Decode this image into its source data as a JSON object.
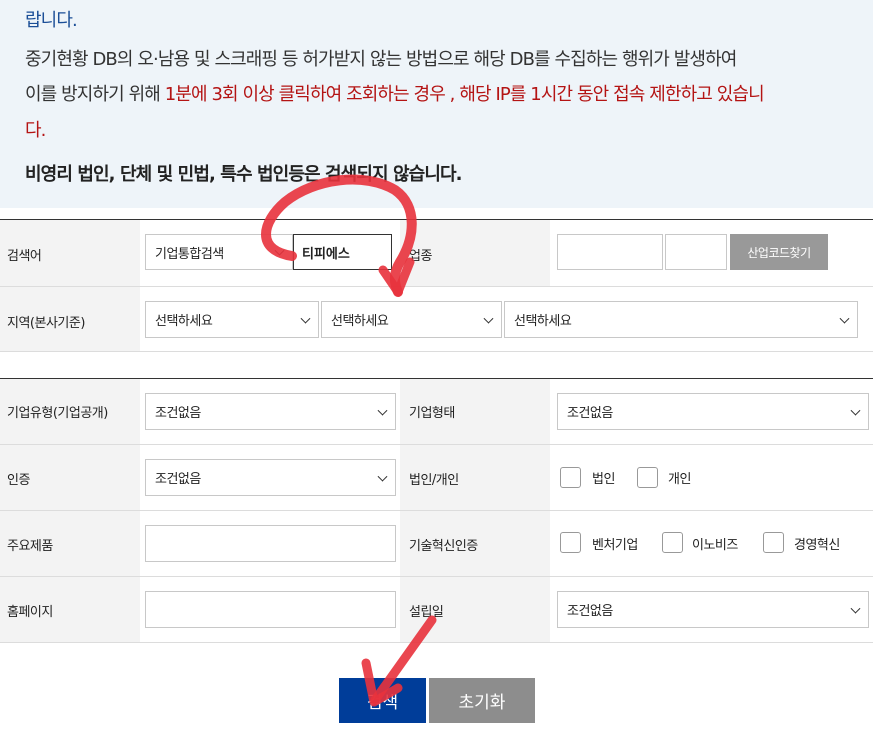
{
  "notice": {
    "line1": "랍니다.",
    "line2": "중기현황 DB의 오·남용 및 스크래핑 등 허가받지 않는 방법으로 해당 DB를 수집하는 행위가 발생하여",
    "line3_prefix": "이를 방지하기 위해 ",
    "line3_red": "1분에 3회 이상 클릭하여 조회하는 경우 , 해당 IP를 1시간 동안 접속 제한하고 있습니",
    "line4_red": "다.",
    "line5": "비영리 법인, 단체 및 민법, 특수 법인등은 검색되지 않습니다."
  },
  "search": {
    "keyword_label": "검색어",
    "keyword_type": "기업통합검색",
    "keyword_value": "티피에스",
    "industry_label": "업종",
    "industry_code_button": "산업코드찾기",
    "region_label": "지역(본사기준)",
    "region_placeholder_1": "선택하세요",
    "region_placeholder_2": "선택하세요",
    "region_placeholder_3": "선택하세요"
  },
  "filters": {
    "company_type_label": "기업유형(기업공개)",
    "company_type_value": "조건없음",
    "company_form_label": "기업형태",
    "company_form_value": "조건없음",
    "cert_label": "인증",
    "cert_value": "조건없음",
    "corp_label": "법인/개인",
    "corp_options": [
      "법인",
      "개인"
    ],
    "product_label": "주요제품",
    "product_value": "",
    "tech_label": "기술혁신인증",
    "tech_options": [
      "벤처기업",
      "이노비즈",
      "경영혁신"
    ],
    "homepage_label": "홈페이지",
    "homepage_value": "",
    "founded_label": "설립일",
    "founded_value": "조건없음"
  },
  "buttons": {
    "search": "검색",
    "reset": "초기화"
  },
  "colors": {
    "notice_bg": "#eef4f9",
    "notice_link": "#1b4e97",
    "warning_red": "#b41414",
    "search_button": "#003d99",
    "reset_button": "#8d8d8d",
    "annotation_red": "#e8323c"
  }
}
